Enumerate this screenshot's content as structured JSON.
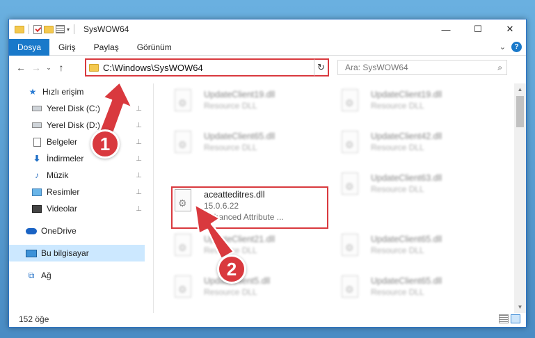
{
  "window": {
    "title": "SysWOW64",
    "controls": {
      "minimize": "—",
      "maximize": "☐",
      "close": "✕"
    }
  },
  "ribbon": {
    "tabs": [
      "Dosya",
      "Giriş",
      "Paylaş",
      "Görünüm"
    ],
    "help": "?",
    "expand": "⌄"
  },
  "nav": {
    "back": "←",
    "forward": "→",
    "recent": "⌄",
    "up": "↑",
    "address": "C:\\Windows\\SysWOW64",
    "refresh": "↻",
    "search_placeholder": "Ara: SysWOW64",
    "search_icon": "⌕"
  },
  "sidebar": {
    "items": [
      {
        "label": "Hızlı erişim",
        "icon": "star-icon"
      },
      {
        "label": "Yerel Disk (C:)",
        "icon": "drive-icon"
      },
      {
        "label": "Yerel Disk (D:)",
        "icon": "drive-icon"
      },
      {
        "label": "Belgeler",
        "icon": "document-icon"
      },
      {
        "label": "İndirmeler",
        "icon": "download-icon"
      },
      {
        "label": "Müzik",
        "icon": "music-icon"
      },
      {
        "label": "Resimler",
        "icon": "pictures-icon"
      },
      {
        "label": "Videolar",
        "icon": "video-icon"
      },
      {
        "label": "OneDrive",
        "icon": "cloud-icon"
      },
      {
        "label": "Bu bilgisayar",
        "icon": "computer-icon"
      },
      {
        "label": "Ağ",
        "icon": "network-icon"
      }
    ],
    "pin": "📌"
  },
  "files": {
    "highlighted": {
      "name": "aceatteditres.dll",
      "version": "15.0.6.22",
      "desc": "Enhanced Attribute ..."
    },
    "blurred": [
      {
        "name": "UpdateClient19.dll",
        "desc": "Resource DLL"
      },
      {
        "name": "UpdateClient19.dll",
        "desc": "Resource DLL"
      },
      {
        "name": "UpdateClient65.dll",
        "desc": "Resource DLL"
      },
      {
        "name": "UpdateClient42.dll",
        "desc": "Resource DLL"
      },
      {
        "name": "UpdateClient63.dll",
        "desc": "Resource DLL"
      },
      {
        "name": "UpdateClient21.dll",
        "desc": "Resource DLL"
      },
      {
        "name": "UpdateClient65.dll",
        "desc": "Resource DLL"
      },
      {
        "name": "UpdateClient5.dll",
        "desc": "Resource DLL"
      },
      {
        "name": "UpdateClient65.dll",
        "desc": "Resource DLL"
      }
    ]
  },
  "status": {
    "count": "152 öğe"
  },
  "callouts": {
    "one": "1",
    "two": "2"
  },
  "colors": {
    "accent": "#1979ca",
    "highlight": "#d9393e",
    "selected": "#cce8ff"
  }
}
